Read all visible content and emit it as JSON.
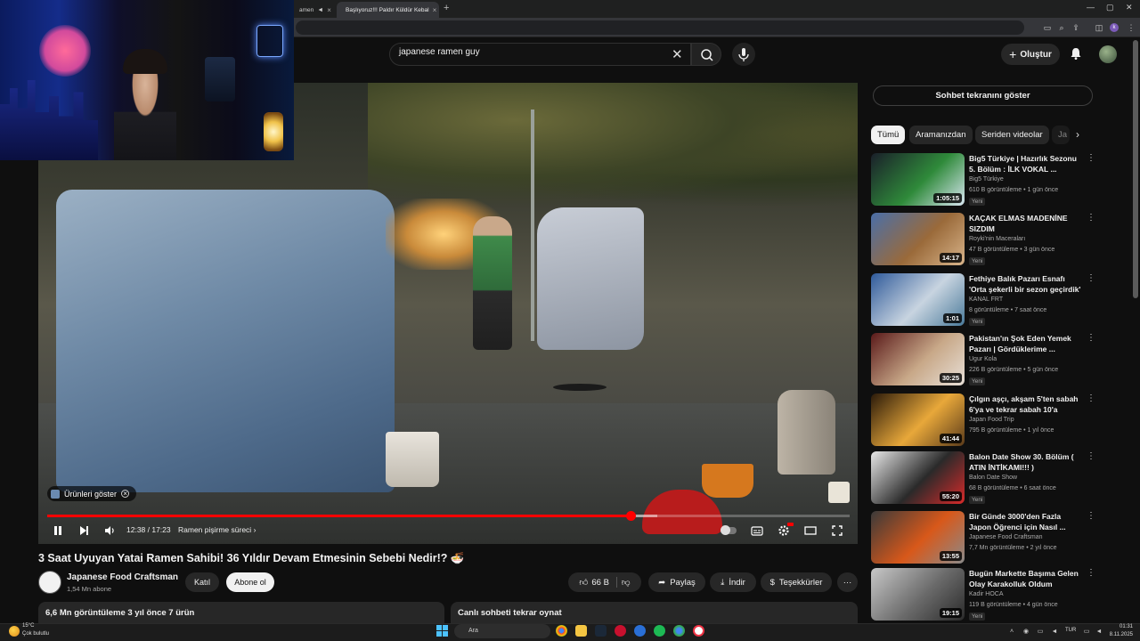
{
  "browser": {
    "tabs": [
      {
        "label": "amen",
        "active": false
      },
      {
        "label": "Başlıyoruz!!! Paldır Küldür Kebal",
        "active": true
      }
    ],
    "new_tab_icon": "plus-icon",
    "window_controls": [
      "minimize-icon",
      "maximize-icon",
      "close-icon"
    ]
  },
  "header": {
    "search_value": "japanese ramen guy",
    "create_label": "Oluştur",
    "icons": [
      "clear-icon",
      "search-icon",
      "mic-icon",
      "bell-icon",
      "avatar"
    ]
  },
  "player": {
    "products_chip": "Ürünleri göster",
    "time": "12:38 / 17:23",
    "chapter": "Ramen pişirme süreci",
    "progress_played": 0.727,
    "progress_buffered": 0.76,
    "controls": [
      "pause-icon",
      "next-icon",
      "volume-icon",
      "autoplay-toggle",
      "subtitles-icon",
      "settings-icon",
      "theater-icon",
      "fullscreen-icon"
    ]
  },
  "video": {
    "title": "3 Saat Uyuyan Yatai Ramen Sahibi! 36 Yıldır Devam Etmesinin Sebebi Nedir!? 🍜",
    "channel": "Japanese Food Craftsman",
    "subscribers": "1,54 Mn abone",
    "join_label": "Katıl",
    "subscribe_label": "Abone ol",
    "likes": "66 B",
    "share_label": "Paylaş",
    "download_label": "İndir",
    "thanks_label": "Teşekkürler",
    "description_meta": "6,6 Mn görüntüleme  3 yıl önce  7 ürün",
    "chat_replay_label": "Canlı sohbeti tekrar oynat"
  },
  "sidebar": {
    "chat_toggle_label": "Sohbet tekranını göster",
    "chips": [
      "Tümü",
      "Aramanızdan",
      "Seriden videolar",
      "Ja"
    ],
    "recommendations": [
      {
        "title": "Big5 Türkiye | Hazırlık Sezonu 5. Bölüm : İLK VOKAL ...",
        "channel": "Big5 Türkiye",
        "meta": "610 B görüntüleme • 1 gün önce",
        "badge": "Yeni",
        "duration": "1:05:15",
        "colors": [
          "#1a1f2a",
          "#2f8a3a",
          "#d9e7f2"
        ]
      },
      {
        "title": "KAÇAK ELMAS MADENİNE SIZDIM",
        "channel": "Royki'nin Maceraları",
        "meta": "47 B görüntüleme • 3 gün önce",
        "badge": "Yeni",
        "duration": "14:17",
        "colors": [
          "#4a6fa8",
          "#9a6a3a",
          "#d8b48a"
        ]
      },
      {
        "title": "Fethiye Balık Pazarı Esnafı 'Orta şekerli bir sezon geçirdik'",
        "channel": "KANAL FRT",
        "meta": "8 görüntüleme • 7 saat önce",
        "badge": "Yeni",
        "duration": "1:01",
        "colors": [
          "#2f5a9a",
          "#c8d4e0",
          "#4a7a9a"
        ]
      },
      {
        "title": "Pakistan'ın Şok Eden Yemek Pazarı | Gördüklerime ...",
        "channel": "Ugur Kola",
        "meta": "226 B görüntüleme • 5 gün önce",
        "badge": "Yeni",
        "duration": "30:25",
        "colors": [
          "#5a1a1a",
          "#c8a888",
          "#e8e0d8"
        ]
      },
      {
        "title": "Çılgın aşçı, akşam 5'ten sabah 6'ya ve tekrar sabah 10'a kada...",
        "channel": "Japan Food Trip",
        "meta": "795 B görüntüleme • 1 yıl önce",
        "badge": "",
        "duration": "41:44",
        "colors": [
          "#2a1a0a",
          "#e8a83a",
          "#5a3a1a"
        ]
      },
      {
        "title": "Balon Date Show 30. Bölüm ( ATIN İNTİKAMI!!! )",
        "channel": "Balon Date Show",
        "meta": "68 B görüntüleme • 6 saat önce",
        "badge": "Yeni",
        "duration": "55:20",
        "colors": [
          "#e8e8e8",
          "#2a2a2a",
          "#d82a2a"
        ]
      },
      {
        "title": "Bir Günde 3000'den Fazla Japon Öğrenci için Nasıl ...",
        "channel": "Japanese Food Craftsman",
        "meta": "7,7 Mn görüntüleme • 2 yıl önce",
        "badge": "",
        "duration": "13:55",
        "colors": [
          "#3a3a3a",
          "#d8581a",
          "#8a8a8a"
        ]
      },
      {
        "title": "Bugün Markette Başıma Gelen Olay Karakolluk Oldum",
        "channel": "Kadir HOCA",
        "meta": "119 B görüntüleme • 4 gün önce",
        "badge": "Yeni",
        "duration": "19:15",
        "colors": [
          "#c8c8c8",
          "#6a6a6a",
          "#2a2a2a"
        ]
      }
    ]
  },
  "taskbar": {
    "weather_temp": "15°C",
    "weather_desc": "Çok bulutlu",
    "search_label": "Ara",
    "lang": "TUR",
    "time": "01:31",
    "date": "8.11.2025"
  },
  "colors": {
    "accent_red": "#ff0000",
    "background": "#0f0f0f",
    "chip_bg": "#272727"
  }
}
